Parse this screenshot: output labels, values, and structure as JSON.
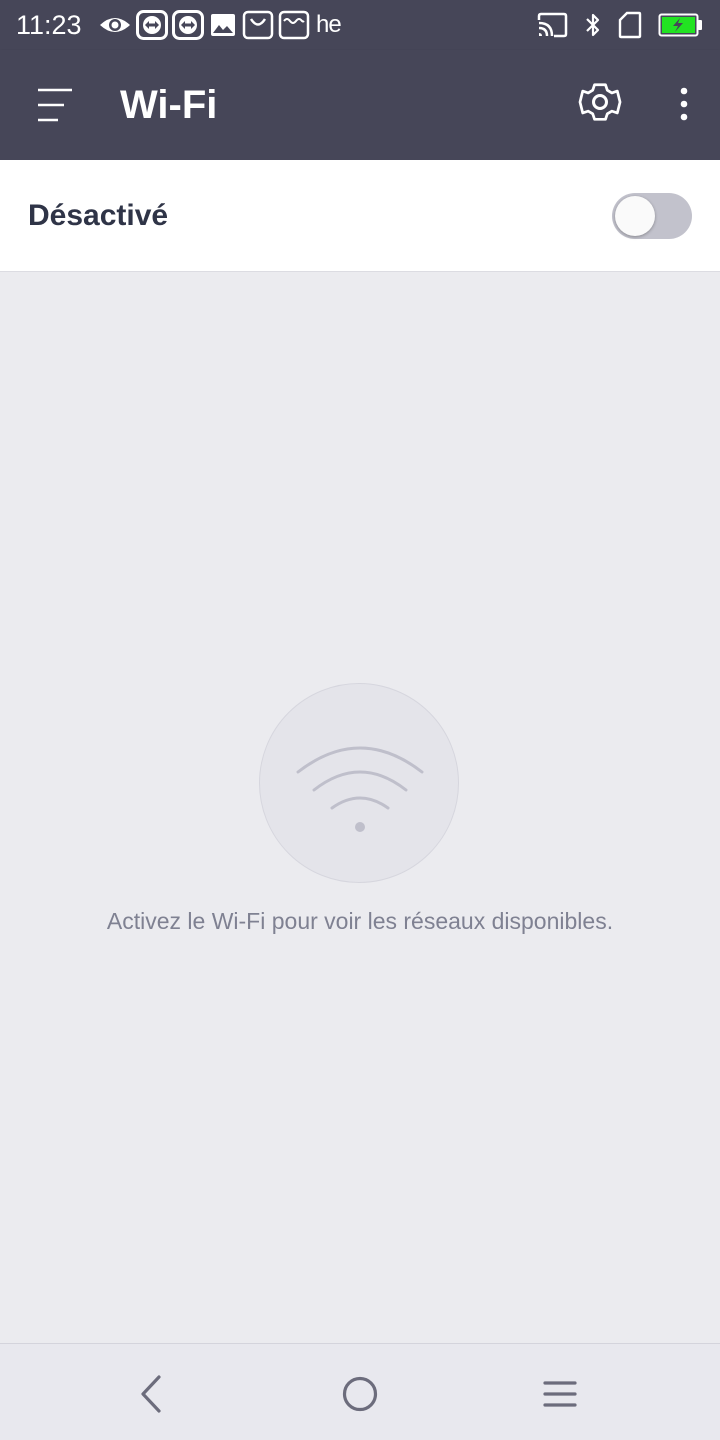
{
  "status_bar": {
    "time": "11:23",
    "carrier_badge": "he",
    "left_icons": [
      "eye-icon",
      "teamviewer-icon",
      "teamviewer-icon",
      "image-icon",
      "shopping-bag-icon",
      "mail-icon"
    ],
    "right_icons": [
      "cast-icon",
      "bluetooth-icon",
      "sim-card-icon",
      "battery-charging-icon"
    ],
    "battery_color": "#22e322"
  },
  "app_bar": {
    "title": "Wi-Fi",
    "background_color": "#464658"
  },
  "wifi_toggle": {
    "label": "Désactivé",
    "state": "off"
  },
  "empty_state": {
    "icon": "wifi-icon",
    "message": "Activez le Wi-Fi pour voir les réseaux disponibles."
  },
  "nav_bar": {
    "buttons": [
      "back-icon",
      "home-icon",
      "recent-apps-icon"
    ]
  }
}
